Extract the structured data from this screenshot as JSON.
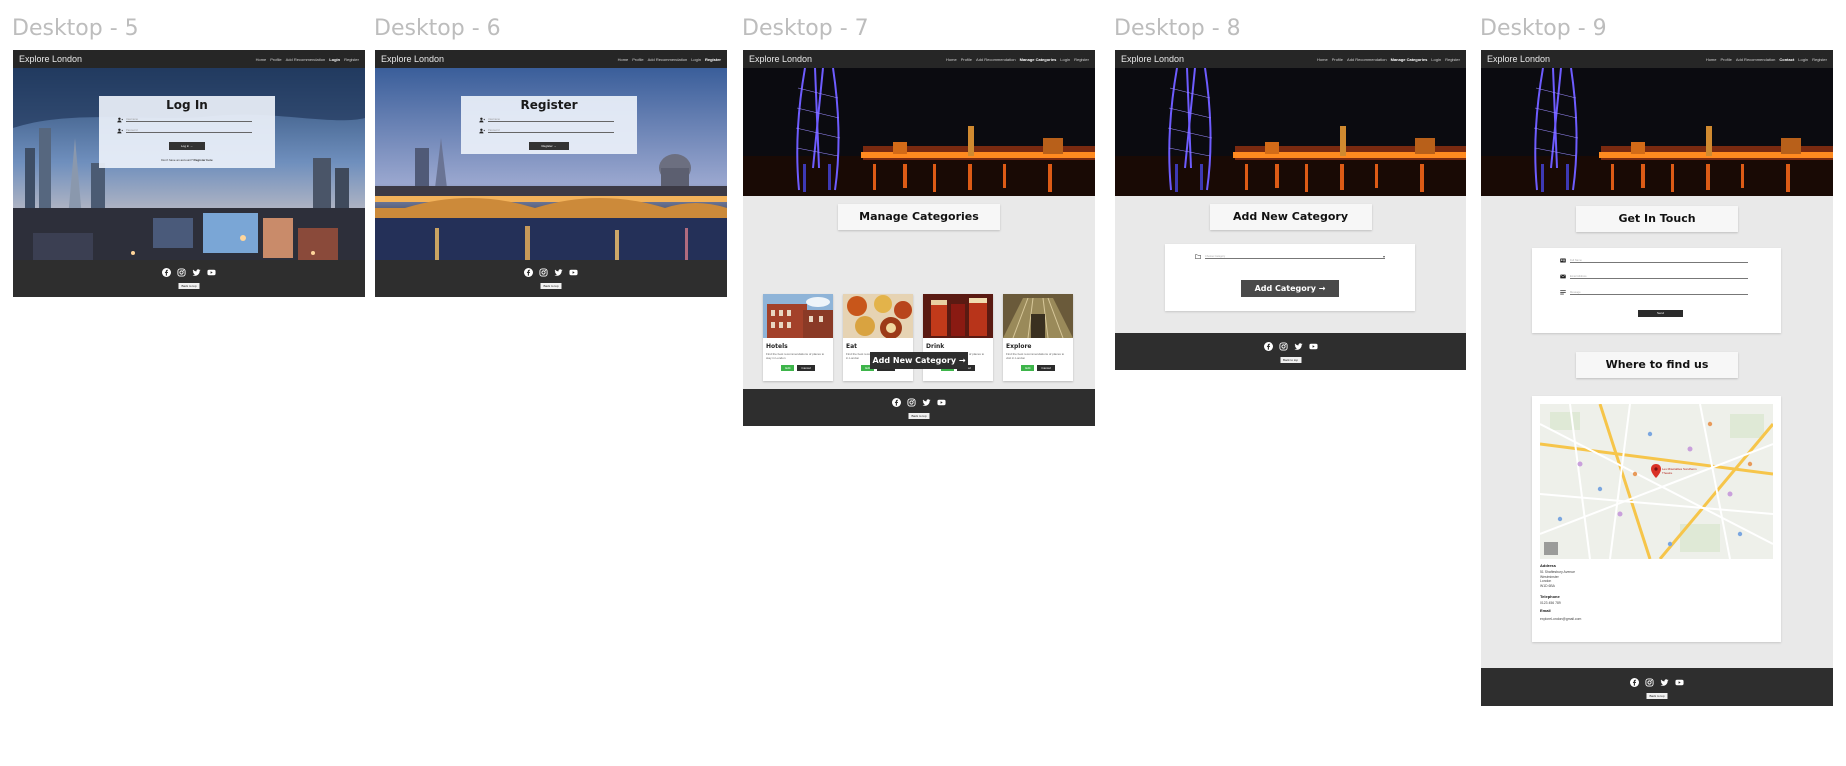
{
  "brand": "Explore London",
  "nav_items": {
    "home": "Home",
    "profile": "Profile",
    "add_recommendation": "Add Recommendation",
    "manage_categories": "Manage Categories",
    "contact": "Contact",
    "login": "Login",
    "register": "Register"
  },
  "back_to_top": "Back to top",
  "social_icons": [
    "facebook-icon",
    "instagram-icon",
    "twitter-icon",
    "youtube-icon"
  ],
  "frames": [
    {
      "title": "Desktop - 5",
      "active_nav": "login",
      "panel_title": "Log In",
      "fields": [
        {
          "placeholder": "Username",
          "icon": "user-icon"
        },
        {
          "placeholder": "Password",
          "icon": "user-icon"
        }
      ],
      "button": "Log in →",
      "note_prefix": "Don't have an account?",
      "note_link": "Register here"
    },
    {
      "title": "Desktop - 6",
      "active_nav": "register",
      "panel_title": "Register",
      "fields": [
        {
          "placeholder": "Username",
          "icon": "user-icon"
        },
        {
          "placeholder": "Password",
          "icon": "user-icon"
        }
      ],
      "button": "Register →"
    },
    {
      "title": "Desktop - 7",
      "active_nav": "manage_categories",
      "heading": "Manage Categories",
      "cards": [
        {
          "title": "Hotels",
          "description": "Find the best recommendations of places to stay in London",
          "edit": "Edit",
          "cancel": "Cancel"
        },
        {
          "title": "Eat",
          "description": "Find the best recommendations of places to eat in London",
          "edit": "Edit",
          "cancel": "Cancel"
        },
        {
          "title": "Drink",
          "description": "Find the best recommendations of places to drink in London",
          "edit": "Edit",
          "cancel": "Cancel"
        },
        {
          "title": "Explore",
          "description": "Find the best recommendations of places to visit in London",
          "edit": "Edit",
          "cancel": "Cancel"
        }
      ],
      "add_button": "Add New Category →"
    },
    {
      "title": "Desktop - 8",
      "active_nav": "manage_categories",
      "heading": "Add New Category",
      "input_placeholder": "Choose Category",
      "add_button": "Add Category →"
    },
    {
      "title": "Desktop - 9",
      "active_nav": "contact",
      "heading": "Get In Touch",
      "fields": [
        {
          "placeholder": "Full Name",
          "icon": "user-card-icon"
        },
        {
          "placeholder": "Email Address",
          "icon": "email-icon"
        },
        {
          "placeholder": "Message",
          "icon": "message-icon"
        }
      ],
      "send_button": "Send",
      "heading2": "Where to find us",
      "map_pin_label": "Les Misérables Sondheim Theatre",
      "address_label": "Address",
      "address_lines": "51 Shaftesbury Avenue\nWestminster\nLondon\nW1D 6BA",
      "telephone_label": "Telephone",
      "telephone": "0123 456 789",
      "email_label": "Email",
      "email": "exploreLondon@gmail.com"
    }
  ],
  "colors": {
    "nav_bg": "#262626",
    "footer_bg": "#2e2e2e",
    "page_bg": "#e9e9e9",
    "edit_green": "#3db54a",
    "dark_button": "#2f2f2f"
  }
}
